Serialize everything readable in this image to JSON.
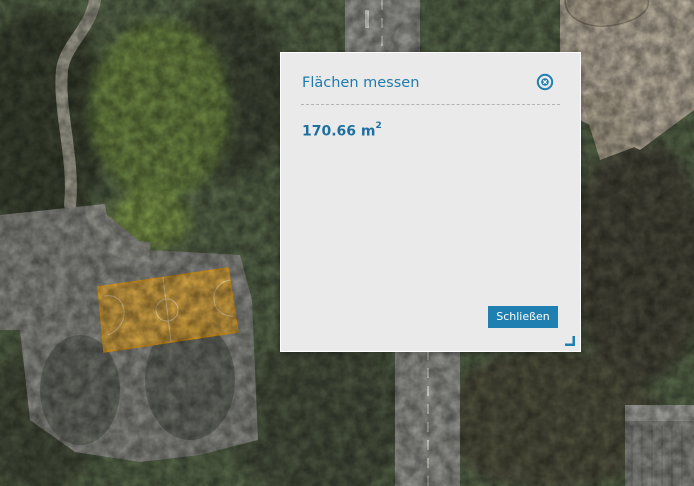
{
  "dialog": {
    "title": "Flächen messen",
    "measurement_value": "170.66 m",
    "measurement_unit_exponent": "2",
    "close_button_label": "Schließen"
  },
  "colors": {
    "accent": "#1e7fb0",
    "title": "#1f7bab",
    "measured_area_fill": "#f2b233",
    "dialog_background": "#eaeaea"
  },
  "icons": {
    "close": "close-circle-icon",
    "resize": "resize-corner-icon"
  }
}
